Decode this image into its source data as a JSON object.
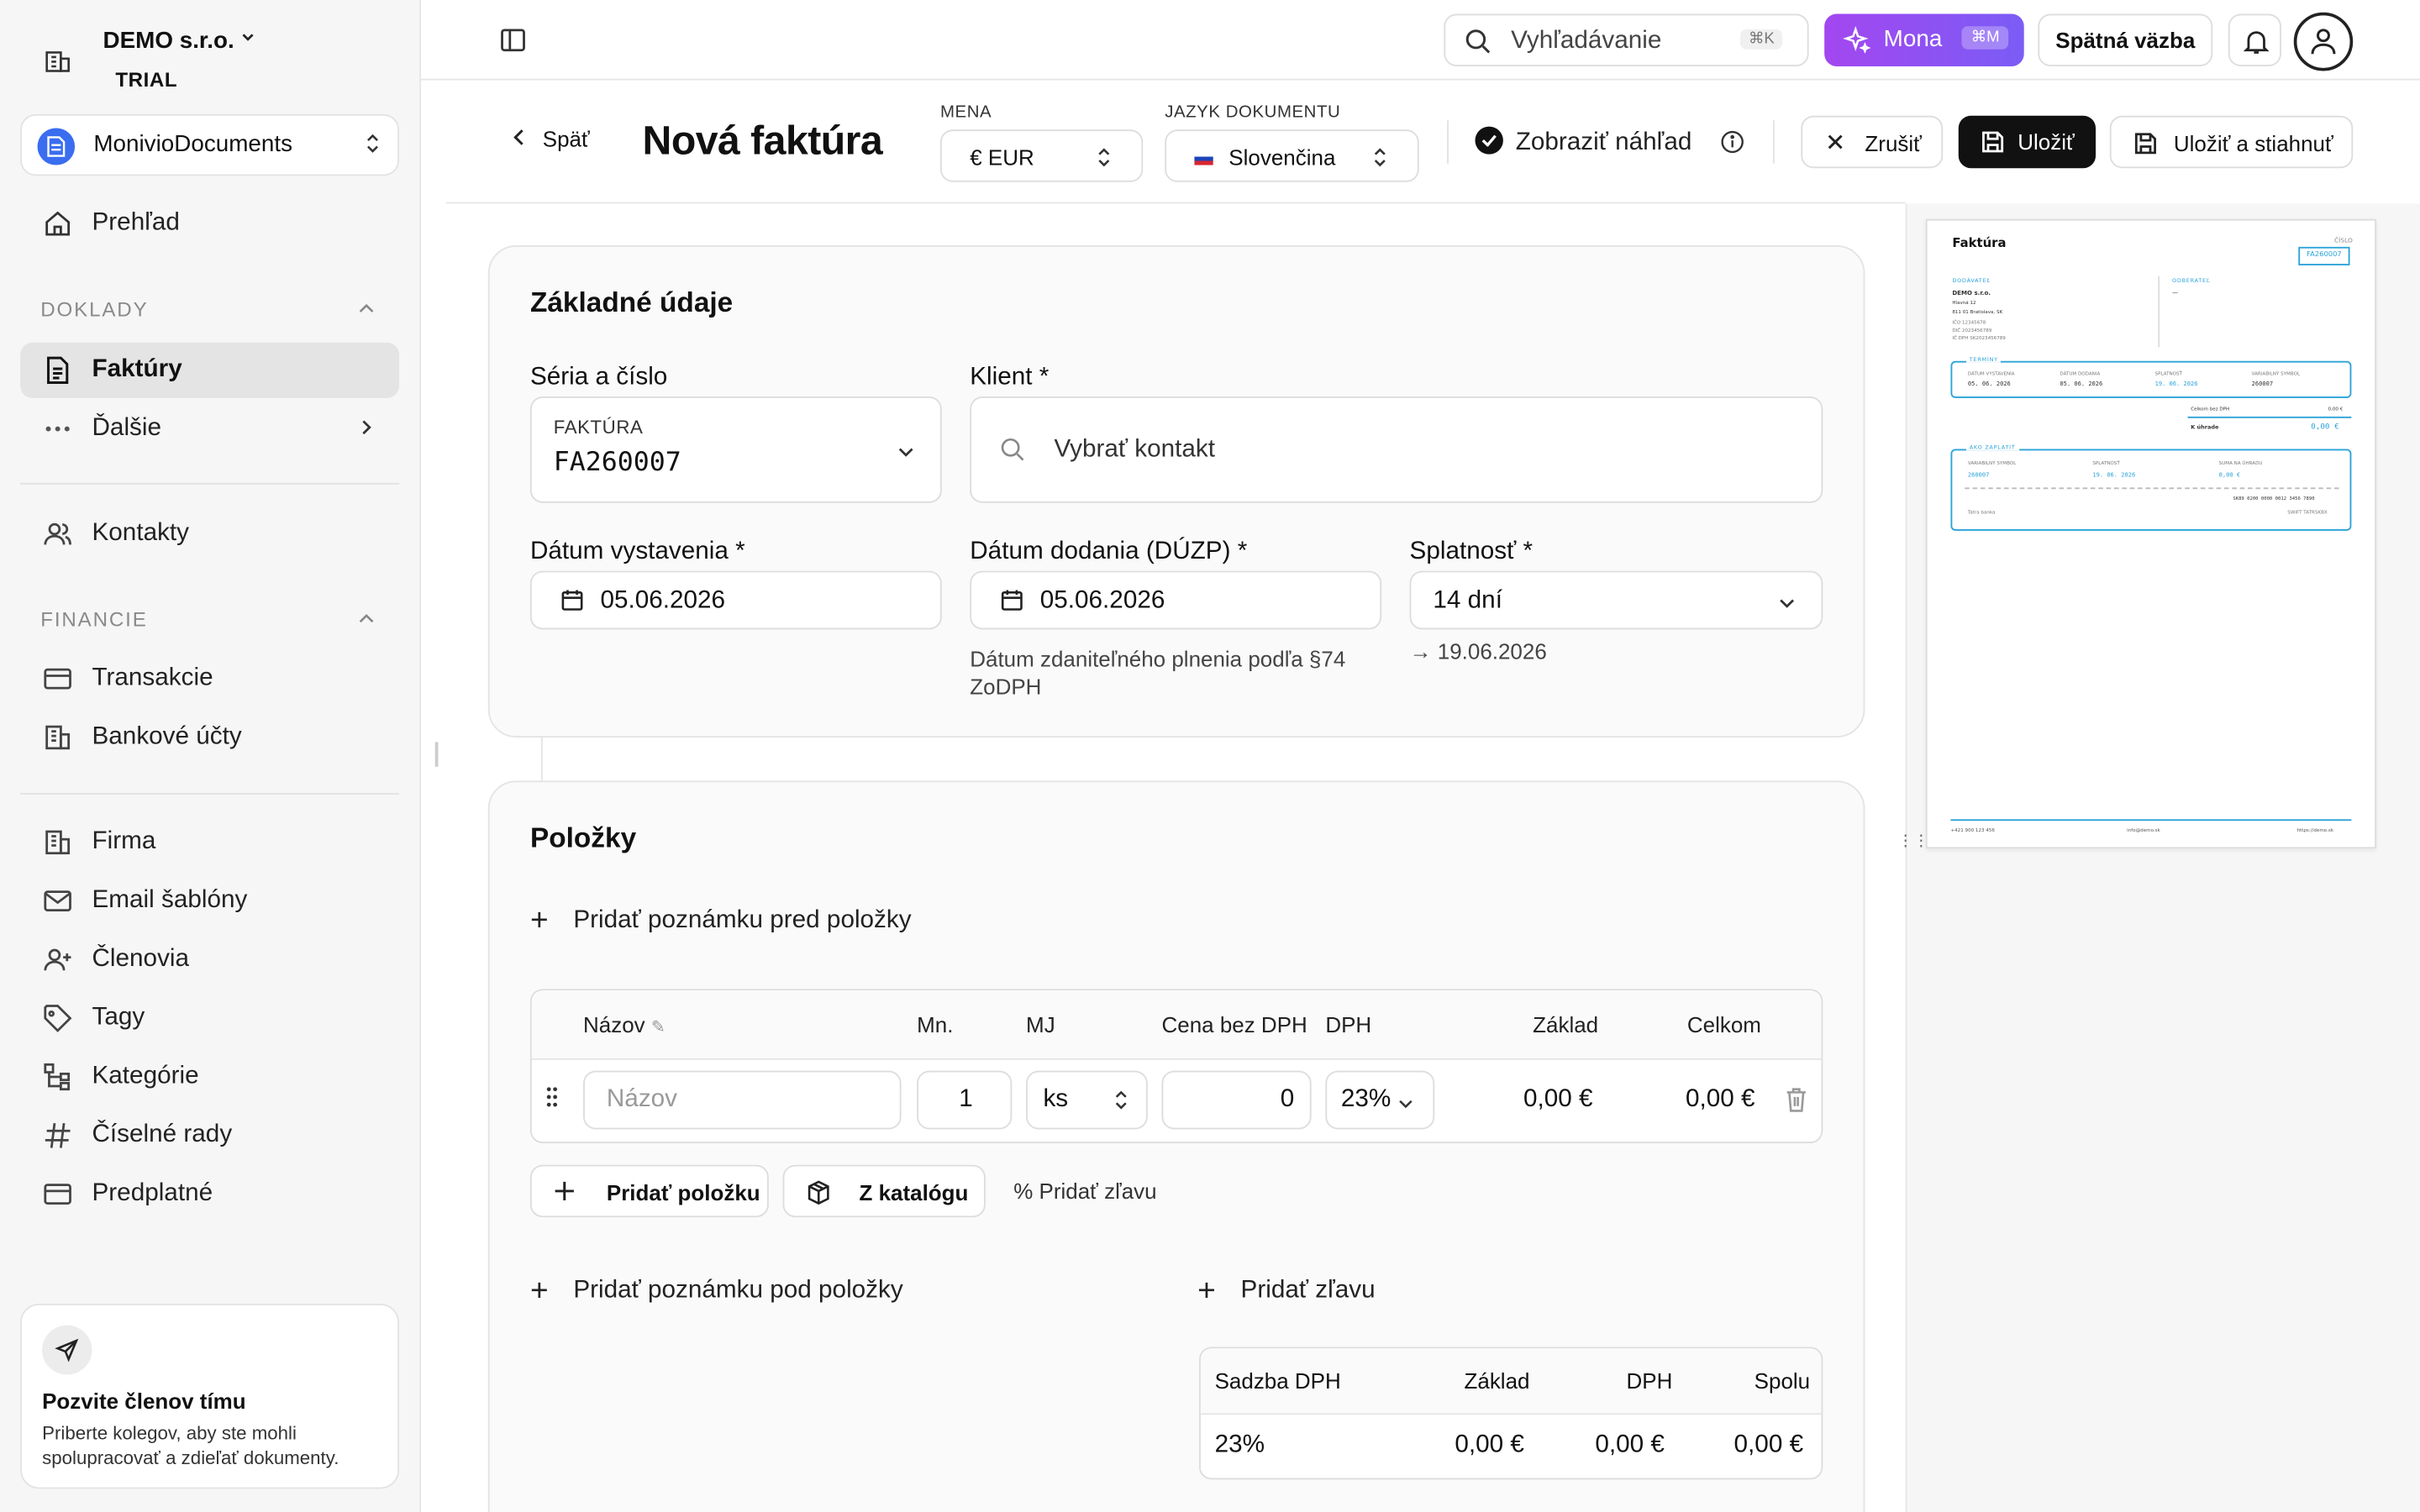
{
  "company": {
    "name": "DEMO s.r.o.",
    "plan": "TRIAL"
  },
  "workspace": {
    "name": "MonivioDocuments"
  },
  "sidebar": {
    "overview": "Prehľad",
    "section_doklady": "DOKLADY",
    "invoices": "Faktúry",
    "more": "Ďalšie",
    "contacts": "Kontakty",
    "section_finance": "FINANCIE",
    "transactions": "Transakcie",
    "bank_accounts": "Bankové účty",
    "company": "Firma",
    "email_templates": "Email šablóny",
    "members": "Členovia",
    "tags": "Tagy",
    "categories": "Kategórie",
    "number_series": "Číselné rady",
    "subscription": "Predplatné",
    "invite_title": "Pozvite členov tímu",
    "invite_desc": "Priberte kolegov, aby ste mohli spolupracovať a zdieľať dokumenty."
  },
  "topbar": {
    "search_placeholder": "Vyhľadávanie",
    "search_shortcut": "⌘K",
    "mona_label": "Mona",
    "mona_shortcut": "⌘M",
    "feedback": "Spätná väzba"
  },
  "header": {
    "back": "Späť",
    "title": "Nová faktúra",
    "currency_label": "MENA",
    "currency_value": "€ EUR",
    "language_label": "JAZYK DOKUMENTU",
    "language_value": "Slovenčina",
    "preview_toggle": "Zobraziť náhľad",
    "cancel": "Zrušiť",
    "save": "Uložiť",
    "save_download": "Uložiť a stiahnuť"
  },
  "basic": {
    "heading": "Základné údaje",
    "series_label": "Séria a číslo",
    "series_type": "FAKTÚRA",
    "series_number": "FA260007",
    "client_label": "Klient *",
    "client_placeholder": "Vybrať kontakt",
    "issue_label": "Dátum vystavenia *",
    "issue_value": "05.06.2026",
    "delivery_label": "Dátum dodania (DÚZP) *",
    "delivery_value": "05.06.2026",
    "delivery_hint": "Dátum zdaniteľného plnenia podľa §74 ZoDPH",
    "due_label": "Splatnosť *",
    "due_value": "14 dní",
    "due_date": "→ 19.06.2026"
  },
  "items": {
    "heading": "Položky",
    "add_note_before": "Pridať poznámku pred položky",
    "columns": [
      "Názov",
      "Mn.",
      "MJ",
      "Cena bez DPH",
      "DPH",
      "Základ",
      "Celkom"
    ],
    "row": {
      "name_placeholder": "Názov",
      "qty": "1",
      "unit": "ks",
      "price": "0",
      "vat": "23%",
      "base": "0,00 €",
      "total": "0,00 €"
    },
    "add_item": "Pridať položku",
    "from_catalog": "Z katalógu",
    "add_discount_small": "% Pridať zľavu",
    "add_note_after": "Pridať poznámku pod položky",
    "add_discount": "Pridať zľavu"
  },
  "vat_table": {
    "columns": [
      "Sadzba DPH",
      "Základ",
      "DPH",
      "Spolu"
    ],
    "row": [
      "23%",
      "0,00 €",
      "0,00 €",
      "0,00 €"
    ]
  },
  "preview": {
    "title": "Faktúra",
    "number_label": "ČÍSLO",
    "number": "FA260007",
    "supplier_label": "DODÁVATEĽ",
    "supplier_name": "DEMO s.r.o.",
    "supplier_street": "Hlavná 12",
    "supplier_city": "811 01 Bratislava, SK",
    "ico": "IČO 12345678",
    "dic": "DIČ 2023456789",
    "icdph": "IČ DPH SK2023456789",
    "customer_label": "ODBERATEĽ",
    "customer_value": "—",
    "terms_label": "TERMÍNY",
    "terms_cols": [
      "DÁTUM VYSTAVENIA",
      "DÁTUM DODANIA",
      "SPLATNOSŤ",
      "VARIABILNÝ SYMBOL"
    ],
    "terms_vals": [
      "05. 06. 2026",
      "05. 06. 2026",
      "19. 06. 2026",
      "260007"
    ],
    "sum_vat_label": "Celkom bez DPH",
    "sum_vat": "0,00 €",
    "due_label": "K úhrade",
    "due": "0,00 €",
    "pay_label": "AKO ZAPLATIŤ",
    "pay_cols": [
      "VARIABILNÝ SYMBOL",
      "SPLATNOSŤ",
      "SUMA NA ÚHRADU"
    ],
    "pay_vals": [
      "260007",
      "19. 06. 2026",
      "0,00 €"
    ],
    "iban": "SK89 0200 0000 0012 3456 7890",
    "bank": "Tatra banka",
    "swift": "SWIFT TATRSKBX",
    "footer_phone": "+421 900 123 456",
    "footer_email": "info@demo.sk",
    "footer_web": "https://demo.sk"
  }
}
